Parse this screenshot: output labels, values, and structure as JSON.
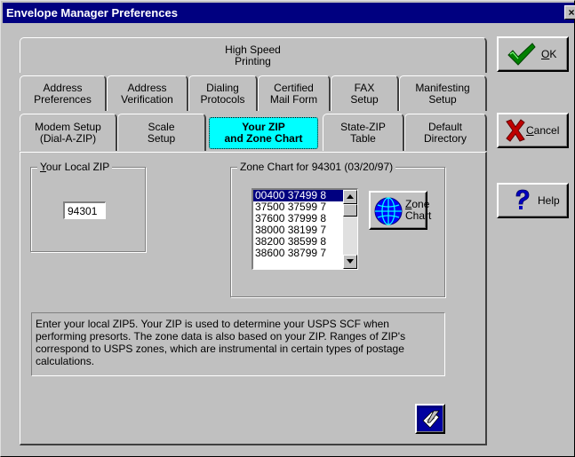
{
  "window": {
    "title": "Envelope Manager Preferences",
    "close_glyph": "×"
  },
  "tabs": {
    "row1": [
      {
        "label": "High Speed\nPrinting"
      }
    ],
    "row2": [
      {
        "label": "Address\nPreferences"
      },
      {
        "label": "Address\nVerification"
      },
      {
        "label": "Dialing\nProtocols"
      },
      {
        "label": "Certified\nMail Form"
      },
      {
        "label": "FAX\nSetup"
      },
      {
        "label": "Manifesting\nSetup"
      }
    ],
    "row3": [
      {
        "label": "Modem Setup\n(Dial-A-ZIP)"
      },
      {
        "label": "Scale\nSetup"
      },
      {
        "label": "Your ZIP\nand Zone Chart",
        "active": true
      },
      {
        "label": "State-ZIP\nTable"
      },
      {
        "label": "Default\nDirectory"
      }
    ]
  },
  "local_zip": {
    "group_label_mnemonic": "Y",
    "group_label_rest": "our Local ZIP",
    "value": "94301"
  },
  "zone_chart": {
    "group_label": "Zone Chart for 94301 (03/20/97)",
    "items": [
      "00400 37499 8",
      "37500 37599 7",
      "37600 37999 8",
      "38000 38199 7",
      "38200 38599 8",
      "38600 38799 7"
    ],
    "selected_index": 0,
    "button_label_mnemonic": "Z",
    "button_label_rest": "one",
    "button_label_line2": "Chart",
    "icon": "globe-icon"
  },
  "help_text": "Enter your local ZIP5.  Your ZIP is used to determine your USPS SCF when performing presorts.  The zone data is also based on your ZIP.  Ranges of ZIP's correspond to USPS zones, which are instrumental in certain types of postage calculations.",
  "side_buttons": {
    "ok": {
      "mnemonic": "O",
      "rest": "K",
      "icon": "checkmark-icon"
    },
    "cancel": {
      "mnemonic": "C",
      "rest": "ancel",
      "icon": "x-icon"
    },
    "help": {
      "mnemonic": "",
      "rest": "Help",
      "icon": "question-mark-icon"
    }
  },
  "colors": {
    "title_bar": "#000080",
    "active_tab": "#00ffff",
    "selection": "#000080",
    "ok_check": "#008000",
    "cancel_x": "#c00000",
    "help_q": "#0000c0"
  }
}
